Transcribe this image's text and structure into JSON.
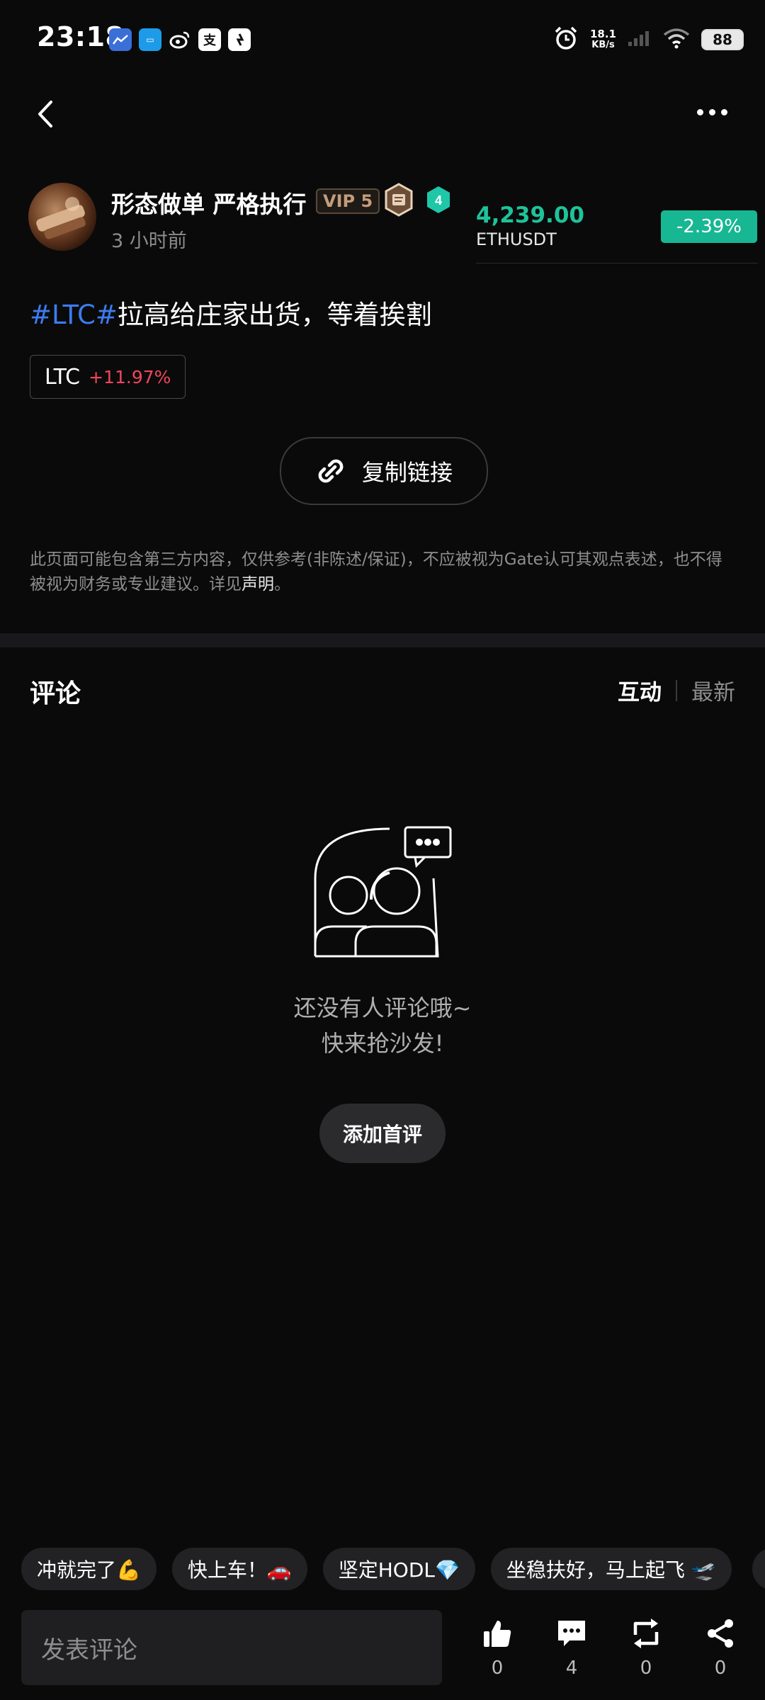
{
  "status_bar": {
    "time": "23:18",
    "net_speed_value": "18.1",
    "net_speed_unit": "KB/s",
    "battery": "88",
    "app_icons": [
      "stock-app-icon",
      "gate-app-icon",
      "weibo-icon",
      "alipay-icon",
      "dingtalk-icon"
    ]
  },
  "author": {
    "name": "形态做单 严格执行",
    "vip": "VIP 5",
    "level": "4",
    "posted": "3 小时前"
  },
  "ticker": {
    "price": "4,239.00",
    "symbol": "ETHUSDT",
    "change": "-2.39%"
  },
  "post": {
    "tag": "#LTC#",
    "text": "拉高给庄家出货，等着挨割",
    "coin_symbol": "LTC",
    "coin_change": "+11.97%",
    "copy_link_label": "复制链接",
    "disclaimer": "此页面可能包含第三方内容，仅供参考(非陈述/保证)，不应被视为Gate认可其观点表述，也不得被视为财务或专业建议。详见",
    "disclaimer_link": "声明",
    "disclaimer_end": "。"
  },
  "comments": {
    "title": "评论",
    "sort_tabs": [
      "互动",
      "最新"
    ],
    "empty_line1": "还没有人评论哦~",
    "empty_line2": "快来抢沙发!",
    "add_first_label": "添加首评"
  },
  "quick_replies": [
    "冲就完了💪",
    "快上车！🚗",
    "坚定HODL💎",
    "坐稳扶好，马上起飞 🛫"
  ],
  "bottom_bar": {
    "input_placeholder": "发表评论",
    "like_count": "0",
    "comment_count": "4",
    "repost_count": "0",
    "share_count": "0"
  },
  "colors": {
    "background": "#0a0a0b",
    "up_green": "#1ec39a",
    "change_badge": "#18b793",
    "down_red": "#f0465a",
    "tag_blue": "#3c7cf0"
  }
}
